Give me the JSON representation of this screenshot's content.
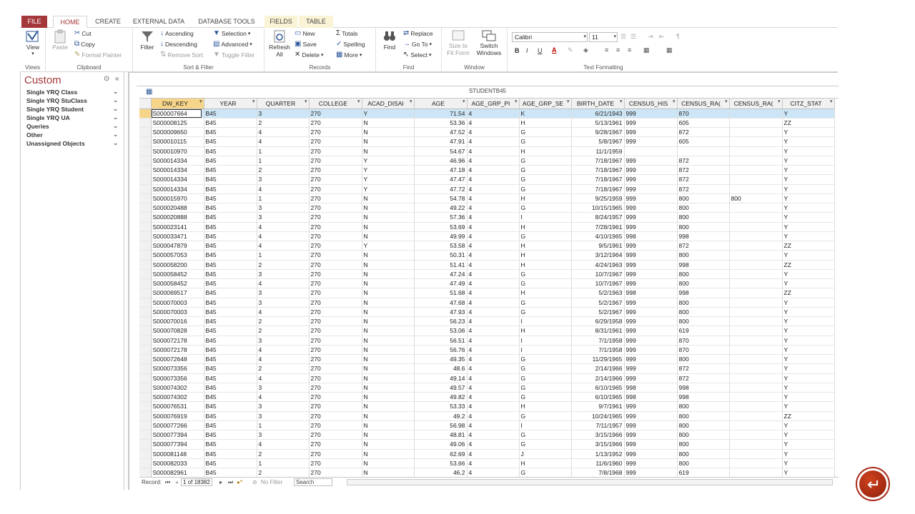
{
  "tabs": {
    "file": "FILE",
    "home": "HOME",
    "create": "CREATE",
    "external": "EXTERNAL DATA",
    "dbtools": "DATABASE TOOLS",
    "fields": "FIELDS",
    "table": "TABLE"
  },
  "ribbon": {
    "views": {
      "label": "Views",
      "view": "View"
    },
    "clipboard": {
      "label": "Clipboard",
      "paste": "Paste",
      "cut": "Cut",
      "copy": "Copy",
      "format_painter": "Format Painter"
    },
    "sortfilter": {
      "label": "Sort & Filter",
      "filter": "Filter",
      "ascending": "Ascending",
      "descending": "Descending",
      "remove_sort": "Remove Sort",
      "selection": "Selection",
      "advanced": "Advanced",
      "toggle_filter": "Toggle Filter"
    },
    "records": {
      "label": "Records",
      "refresh": "Refresh",
      "refresh_all": "All",
      "new": "New",
      "save": "Save",
      "delete": "Delete",
      "totals": "Totals",
      "spelling": "Spelling",
      "more": "More"
    },
    "find": {
      "label": "Find",
      "find": "Find",
      "replace": "Replace",
      "goto": "Go To",
      "select": "Select"
    },
    "window": {
      "label": "Window",
      "size_to": "Size to",
      "fit_form": "Fit Form",
      "switch": "Switch",
      "windows": "Windows"
    },
    "text": {
      "label": "Text Formatting",
      "font": "Calibri",
      "size": "11",
      "bold": "B",
      "italic": "I",
      "underline": "U"
    }
  },
  "nav": {
    "title": "Custom",
    "items": [
      "Single YRQ Class",
      "Single YRQ StuClass",
      "Single YRQ Student",
      "Single YRQ UA",
      "Queries",
      "Other",
      "Unassigned Objects"
    ]
  },
  "document": {
    "title": "STUDENTB45"
  },
  "table": {
    "columns": [
      "DW_KEY",
      "YEAR",
      "QUARTER",
      "COLLEGE",
      "ACAD_DISAI",
      "AGE",
      "AGE_GRP_PI",
      "AGE_GRP_SE",
      "BIRTH_DATE",
      "CENSUS_HIS",
      "CENSUS_RA(",
      "CENSUS_RA(",
      "CITZ_STAT"
    ],
    "rows": [
      [
        "S000007664",
        "B45",
        "3",
        "270",
        "Y",
        "71.54",
        "4",
        "K",
        "6/21/1943",
        "999",
        "870",
        "",
        "Y"
      ],
      [
        "S000008125",
        "B45",
        "2",
        "270",
        "N",
        "53.36",
        "4",
        "H",
        "5/13/1961",
        "999",
        "605",
        "",
        "ZZ"
      ],
      [
        "S000009650",
        "B45",
        "4",
        "270",
        "N",
        "47.52",
        "4",
        "G",
        "9/28/1967",
        "999",
        "872",
        "",
        "Y"
      ],
      [
        "S000010115",
        "B45",
        "4",
        "270",
        "N",
        "47.91",
        "4",
        "G",
        "5/8/1967",
        "999",
        "605",
        "",
        "Y"
      ],
      [
        "S000010970",
        "B45",
        "1",
        "270",
        "N",
        "54.67",
        "4",
        "H",
        "11/1/1959",
        "",
        "",
        "",
        "Y"
      ],
      [
        "S000014334",
        "B45",
        "1",
        "270",
        "Y",
        "46.96",
        "4",
        "G",
        "7/18/1967",
        "999",
        "872",
        "",
        "Y"
      ],
      [
        "S000014334",
        "B45",
        "2",
        "270",
        "Y",
        "47.18",
        "4",
        "G",
        "7/18/1967",
        "999",
        "872",
        "",
        "Y"
      ],
      [
        "S000014334",
        "B45",
        "3",
        "270",
        "Y",
        "47.47",
        "4",
        "G",
        "7/18/1967",
        "999",
        "872",
        "",
        "Y"
      ],
      [
        "S000014334",
        "B45",
        "4",
        "270",
        "Y",
        "47.72",
        "4",
        "G",
        "7/18/1967",
        "999",
        "872",
        "",
        "Y"
      ],
      [
        "S000015970",
        "B45",
        "1",
        "270",
        "N",
        "54.78",
        "4",
        "H",
        "9/25/1959",
        "999",
        "800",
        "800",
        "Y"
      ],
      [
        "S000020488",
        "B45",
        "3",
        "270",
        "N",
        "49.22",
        "4",
        "G",
        "10/15/1965",
        "999",
        "800",
        "",
        "Y"
      ],
      [
        "S000020888",
        "B45",
        "3",
        "270",
        "N",
        "57.36",
        "4",
        "I",
        "8/24/1957",
        "999",
        "800",
        "",
        "Y"
      ],
      [
        "S000023141",
        "B45",
        "4",
        "270",
        "N",
        "53.69",
        "4",
        "H",
        "7/28/1961",
        "999",
        "800",
        "",
        "Y"
      ],
      [
        "S000033471",
        "B45",
        "4",
        "270",
        "N",
        "49.99",
        "4",
        "G",
        "4/10/1965",
        "998",
        "998",
        "",
        "Y"
      ],
      [
        "S000047879",
        "B45",
        "4",
        "270",
        "Y",
        "53.58",
        "4",
        "H",
        "9/5/1961",
        "999",
        "872",
        "",
        "ZZ"
      ],
      [
        "S000057053",
        "B45",
        "1",
        "270",
        "N",
        "50.31",
        "4",
        "H",
        "3/12/1964",
        "999",
        "800",
        "",
        "Y"
      ],
      [
        "S000058200",
        "B45",
        "2",
        "270",
        "N",
        "51.41",
        "4",
        "H",
        "4/24/1963",
        "999",
        "998",
        "",
        "ZZ"
      ],
      [
        "S000058452",
        "B45",
        "3",
        "270",
        "N",
        "47.24",
        "4",
        "G",
        "10/7/1967",
        "999",
        "800",
        "",
        "Y"
      ],
      [
        "S000058452",
        "B45",
        "4",
        "270",
        "N",
        "47.49",
        "4",
        "G",
        "10/7/1967",
        "999",
        "800",
        "",
        "Y"
      ],
      [
        "S000069517",
        "B45",
        "3",
        "270",
        "N",
        "51.68",
        "4",
        "H",
        "5/2/1963",
        "998",
        "998",
        "",
        "ZZ"
      ],
      [
        "S000070003",
        "B45",
        "3",
        "270",
        "N",
        "47.68",
        "4",
        "G",
        "5/2/1967",
        "999",
        "800",
        "",
        "Y"
      ],
      [
        "S000070003",
        "B45",
        "4",
        "270",
        "N",
        "47.93",
        "4",
        "G",
        "5/2/1967",
        "999",
        "800",
        "",
        "Y"
      ],
      [
        "S000070016",
        "B45",
        "2",
        "270",
        "N",
        "56.23",
        "4",
        "I",
        "6/29/1958",
        "999",
        "800",
        "",
        "Y"
      ],
      [
        "S000070828",
        "B45",
        "2",
        "270",
        "N",
        "53.06",
        "4",
        "H",
        "8/31/1961",
        "999",
        "619",
        "",
        "Y"
      ],
      [
        "S000072178",
        "B45",
        "3",
        "270",
        "N",
        "56.51",
        "4",
        "I",
        "7/1/1958",
        "999",
        "870",
        "",
        "Y"
      ],
      [
        "S000072178",
        "B45",
        "4",
        "270",
        "N",
        "56.76",
        "4",
        "I",
        "7/1/1958",
        "999",
        "870",
        "",
        "Y"
      ],
      [
        "S000072648",
        "B45",
        "4",
        "270",
        "N",
        "49.35",
        "4",
        "G",
        "11/29/1965",
        "999",
        "800",
        "",
        "Y"
      ],
      [
        "S000073356",
        "B45",
        "2",
        "270",
        "N",
        "48.6",
        "4",
        "G",
        "2/14/1966",
        "999",
        "872",
        "",
        "Y"
      ],
      [
        "S000073356",
        "B45",
        "4",
        "270",
        "N",
        "49.14",
        "4",
        "G",
        "2/14/1966",
        "999",
        "872",
        "",
        "Y"
      ],
      [
        "S000074302",
        "B45",
        "3",
        "270",
        "N",
        "49.57",
        "4",
        "G",
        "6/10/1965",
        "998",
        "998",
        "",
        "Y"
      ],
      [
        "S000074302",
        "B45",
        "4",
        "270",
        "N",
        "49.82",
        "4",
        "G",
        "6/10/1965",
        "998",
        "998",
        "",
        "Y"
      ],
      [
        "S000076531",
        "B45",
        "3",
        "270",
        "N",
        "53.33",
        "4",
        "H",
        "9/7/1961",
        "999",
        "800",
        "",
        "Y"
      ],
      [
        "S000076919",
        "B45",
        "3",
        "270",
        "N",
        "49.2",
        "4",
        "G",
        "10/24/1965",
        "999",
        "800",
        "",
        "ZZ"
      ],
      [
        "S000077266",
        "B45",
        "1",
        "270",
        "N",
        "56.98",
        "4",
        "I",
        "7/11/1957",
        "999",
        "800",
        "",
        "Y"
      ],
      [
        "S000077394",
        "B45",
        "3",
        "270",
        "N",
        "48.81",
        "4",
        "G",
        "3/15/1966",
        "999",
        "800",
        "",
        "Y"
      ],
      [
        "S000077394",
        "B45",
        "4",
        "270",
        "N",
        "49.06",
        "4",
        "G",
        "3/15/1966",
        "999",
        "800",
        "",
        "Y"
      ],
      [
        "S000081148",
        "B45",
        "2",
        "270",
        "N",
        "62.69",
        "4",
        "J",
        "1/13/1952",
        "999",
        "800",
        "",
        "Y"
      ],
      [
        "S000082033",
        "B45",
        "1",
        "270",
        "N",
        "53.66",
        "4",
        "H",
        "11/6/1960",
        "999",
        "800",
        "",
        "Y"
      ],
      [
        "S000082961",
        "B45",
        "2",
        "270",
        "N",
        "46.2",
        "4",
        "G",
        "7/8/1968",
        "999",
        "619",
        "",
        "Y"
      ]
    ]
  },
  "recordbar": {
    "label": "Record:",
    "position": "1 of 18382",
    "no_filter": "No Filter",
    "search": "Search"
  },
  "colors": {
    "accent": "#a4373a",
    "selected_header": "#f6d58a",
    "current_row": "#cde6f7",
    "orb": "#b8331a"
  }
}
